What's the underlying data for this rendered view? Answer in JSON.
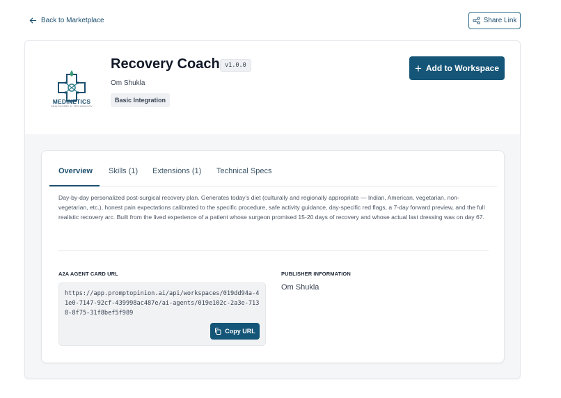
{
  "nav": {
    "back_label": "Back to Marketplace",
    "share_label": "Share Link"
  },
  "agent": {
    "logo_name": "MEDINETICS",
    "logo_tagline": "HEALTHCARE AI TECHNOLOGY",
    "title": "Recovery Coach",
    "version": "v1.0.0",
    "author": "Om Shukla",
    "tag": "Basic Integration",
    "add_label": "Add to Workspace"
  },
  "tabs": [
    {
      "label": "Overview",
      "active": true
    },
    {
      "label": "Skills (1)",
      "active": false
    },
    {
      "label": "Extensions (1)",
      "active": false
    },
    {
      "label": "Technical Specs",
      "active": false
    }
  ],
  "overview": {
    "description": "Day-by-day personalized post-surgical recovery plan. Generates today's diet (culturally and regionally appropriate — Indian, American, vegetarian, non-vegetarian, etc.), honest pain expectations calibrated to the specific procedure, safe activity guidance, day-specific red flags, a 7-day forward preview, and the full realistic recovery arc. Built from the lived experience of a patient whose surgeon promised 15-20 days of recovery and whose actual last dressing was on day 67.",
    "card_url_label": "A2A AGENT CARD URL",
    "card_url": "https://app.promptopinion.ai/api/workspaces/019dd94a-41e0-7147-92cf-439998ac487e/ai-agents/019e102c-2a3e-7138-8f75-31f8bef5f989",
    "copy_label": "Copy URL",
    "publisher_label": "PUBLISHER INFORMATION",
    "publisher_name": "Om Shukla"
  },
  "colors": {
    "primary": "#155577",
    "accent_text": "#1c4f6e",
    "page_bg": "#f5f6f8"
  }
}
